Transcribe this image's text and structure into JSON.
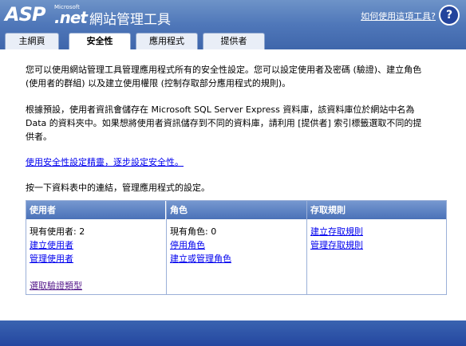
{
  "header": {
    "logo_asp": "ASP",
    "logo_ms": "Microsoft",
    "logo_net": ".net",
    "title": "網站管理工具",
    "help_link": "如何使用這項工具?",
    "help_icon_glyph": "?"
  },
  "tabs": [
    {
      "label": "主網頁",
      "active": false
    },
    {
      "label": "安全性",
      "active": true
    },
    {
      "label": "應用程式",
      "active": false
    },
    {
      "label": "提供者",
      "active": false
    }
  ],
  "intro": {
    "para1_line1": "您可以使用網站管理工具管理應用程式所有的安全性設定。您可以設定使用者及密碼 (驗證)、建立角色",
    "para1_line2": "(使用者的群組) 以及建立使用權限 (控制存取部分應用程式的規則)。",
    "para2_line1": "根據預設，使用者資訊會儲存在 Microsoft SQL Server Express 資料庫，該資料庫位於網站中名為",
    "para2_line2": "Data 的資料夾中。如果想將使用者資訊儲存到不同的資料庫，請利用 [提供者] 索引標籤選取不同的提",
    "para2_line3": "供者。",
    "wizard_link": "使用安全性設定精靈，逐步設定安全性。",
    "instruction": "按一下資料表中的連結，管理應用程式的設定。"
  },
  "panels": {
    "users": {
      "header": "使用者",
      "count_label": "現有使用者: 2",
      "create": "建立使用者",
      "manage": "管理使用者",
      "auth_type": "選取驗證類型"
    },
    "roles": {
      "header": "角色",
      "count_label": "現有角色: 0",
      "disable": "停用角色",
      "create_manage": "建立或管理角色"
    },
    "access": {
      "header": "存取規則",
      "create": "建立存取規則",
      "manage": "管理存取規則"
    }
  },
  "colors": {
    "header_blue": "#4f77b9",
    "link": "#0000ee",
    "visited_link": "#551a8b",
    "panel_border": "#9bb0d8"
  }
}
